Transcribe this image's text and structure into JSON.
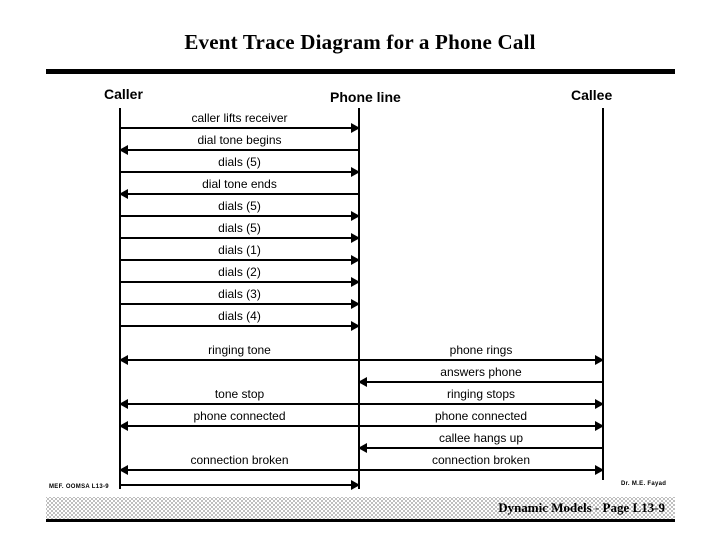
{
  "slide": {
    "title": "Event Trace Diagram for a Phone Call"
  },
  "actors": [
    {
      "id": "caller",
      "label": "Caller"
    },
    {
      "id": "phone_line",
      "label": "Phone line"
    },
    {
      "id": "callee",
      "label": "Callee"
    }
  ],
  "messages": [
    {
      "label": "caller lifts receiver",
      "from": "caller",
      "to": "phone_line",
      "direction": "right"
    },
    {
      "label": "dial tone begins",
      "from": "phone_line",
      "to": "caller",
      "direction": "left"
    },
    {
      "label": "dials (5)",
      "from": "caller",
      "to": "phone_line",
      "direction": "right"
    },
    {
      "label": "dial tone ends",
      "from": "phone_line",
      "to": "caller",
      "direction": "left"
    },
    {
      "label": "dials (5)",
      "from": "caller",
      "to": "phone_line",
      "direction": "right"
    },
    {
      "label": "dials (5)",
      "from": "caller",
      "to": "phone_line",
      "direction": "right"
    },
    {
      "label": "dials (1)",
      "from": "caller",
      "to": "phone_line",
      "direction": "right"
    },
    {
      "label": "dials (2)",
      "from": "caller",
      "to": "phone_line",
      "direction": "right"
    },
    {
      "label": "dials (3)",
      "from": "caller",
      "to": "phone_line",
      "direction": "right"
    },
    {
      "label": "dials (4)",
      "from": "caller",
      "to": "phone_line",
      "direction": "right"
    },
    {
      "label": "ringing tone",
      "from": "phone_line",
      "to": "caller",
      "direction": "left"
    },
    {
      "label": "phone rings",
      "from": "phone_line",
      "to": "callee",
      "direction": "right"
    },
    {
      "label": "answers phone",
      "from": "callee",
      "to": "phone_line",
      "direction": "left"
    },
    {
      "label": "tone stop",
      "from": "phone_line",
      "to": "caller",
      "direction": "left"
    },
    {
      "label": "ringing stops",
      "from": "phone_line",
      "to": "callee",
      "direction": "right"
    },
    {
      "label": "phone connected",
      "from": "phone_line",
      "to": "caller",
      "direction": "left"
    },
    {
      "label": "phone connected",
      "from": "phone_line",
      "to": "callee",
      "direction": "right"
    },
    {
      "label": "callee hangs up",
      "from": "callee",
      "to": "phone_line",
      "direction": "left"
    },
    {
      "label": "connection broken",
      "from": "phone_line",
      "to": "caller",
      "direction": "left"
    },
    {
      "label": "connection broken",
      "from": "phone_line",
      "to": "callee",
      "direction": "right"
    },
    {
      "label": "",
      "from": "caller",
      "to": "phone_line",
      "direction": "right"
    }
  ],
  "footer": {
    "left_code": "MEF. OOMSA L13-9",
    "right_author": "Dr. M.E. Fayad",
    "band_text": "Dynamic Models - Page L13-9"
  },
  "colors": {
    "ink": "#000000",
    "background": "#ffffff"
  }
}
